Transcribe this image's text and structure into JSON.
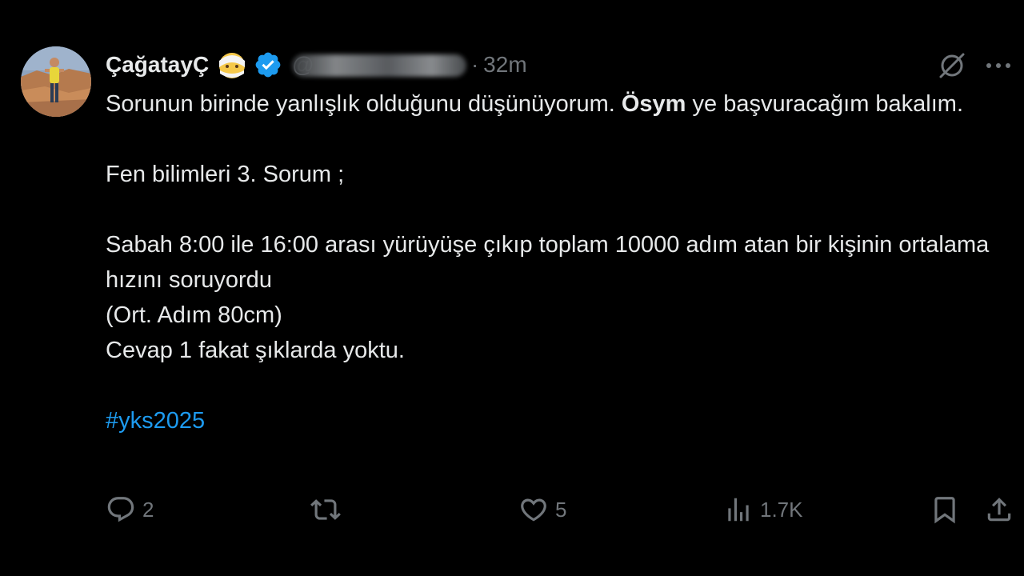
{
  "post": {
    "author_name": "ÇağatayÇ",
    "handle": "@",
    "dot": "·",
    "time": "32m",
    "text": {
      "line1_a": "Sorunun birinde yanlışlık olduğunu düşünüyorum.  ",
      "line1_bold": "Ösym",
      "line1_b": " ye başvuracağım bakalım.",
      "line2": "Fen bilimleri  3. Sorum ;",
      "line3": "Sabah 8:00 ile 16:00 arası yürüyüşe çıkıp toplam 10000 adım atan bir kişinin ortalama hızını soruyordu",
      "line4": "(Ort. Adım 80cm)",
      "line5": "Cevap 1 fakat şıklarda yoktu.",
      "hashtag": "#yks2025"
    }
  },
  "actions": {
    "replies": "2",
    "reposts": "",
    "likes": "5",
    "views": "1.7K"
  },
  "colors": {
    "background": "#000000",
    "text": "#e7e9ea",
    "muted": "#71767b",
    "accent": "#1d9bf0"
  },
  "icons": {
    "reply": "reply-icon",
    "repost": "repost-icon",
    "like": "heart-icon",
    "views": "views-icon",
    "bookmark": "bookmark-icon",
    "share": "share-icon",
    "grok": "grok-icon",
    "more": "more-icon",
    "verified": "verified-badge-icon"
  }
}
